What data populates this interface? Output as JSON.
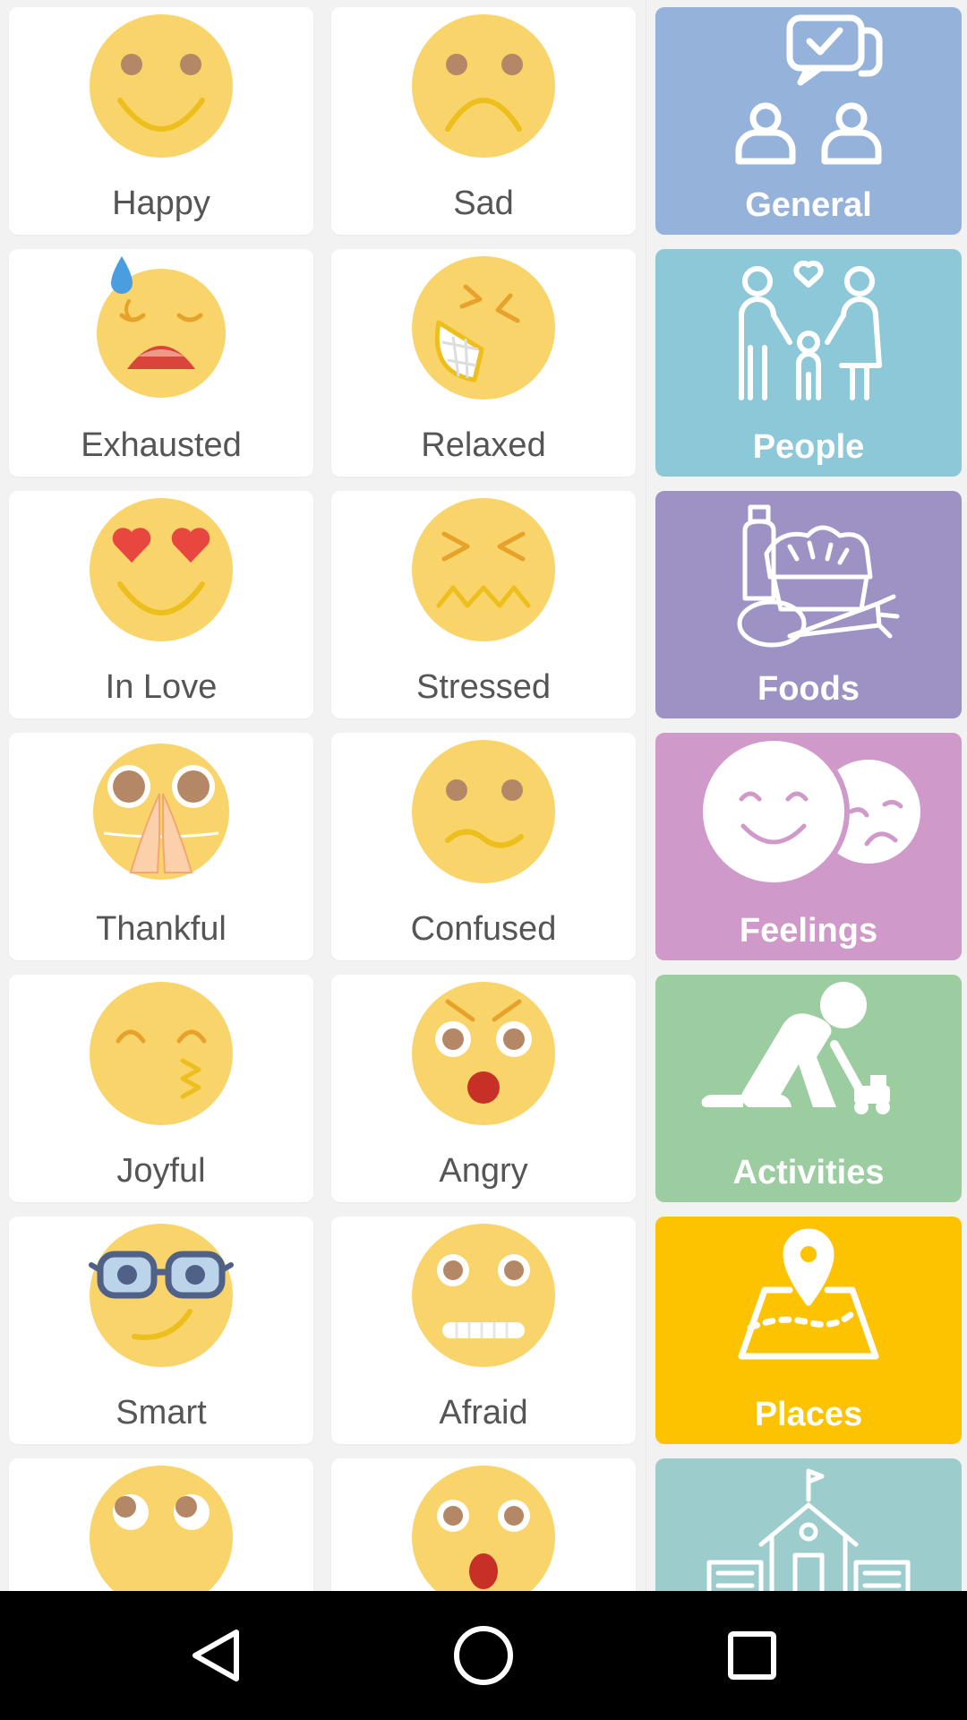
{
  "emotions": [
    {
      "label": "Happy",
      "icon": "happy-face-icon"
    },
    {
      "label": "Sad",
      "icon": "sad-face-icon"
    },
    {
      "label": "Exhausted",
      "icon": "exhausted-face-icon"
    },
    {
      "label": "Relaxed",
      "icon": "relaxed-face-icon"
    },
    {
      "label": "In Love",
      "icon": "in-love-face-icon"
    },
    {
      "label": "Stressed",
      "icon": "stressed-face-icon"
    },
    {
      "label": "Thankful",
      "icon": "thankful-face-icon"
    },
    {
      "label": "Confused",
      "icon": "confused-face-icon"
    },
    {
      "label": "Joyful",
      "icon": "joyful-face-icon"
    },
    {
      "label": "Angry",
      "icon": "angry-face-icon"
    },
    {
      "label": "Smart",
      "icon": "smart-face-icon"
    },
    {
      "label": "Afraid",
      "icon": "afraid-face-icon"
    }
  ],
  "categories": [
    {
      "label": "General",
      "icon": "people-chat-icon",
      "color": "#95b3da"
    },
    {
      "label": "People",
      "icon": "family-icon",
      "color": "#8dc8d8"
    },
    {
      "label": "Foods",
      "icon": "groceries-icon",
      "color": "#9e92c4"
    },
    {
      "label": "Feelings",
      "icon": "masks-icon",
      "color": "#cf99c9"
    },
    {
      "label": "Activities",
      "icon": "child-playing-icon",
      "color": "#9bcda1"
    },
    {
      "label": "Places",
      "icon": "map-pin-icon",
      "color": "#fdc300"
    },
    {
      "label": "",
      "icon": "school-icon",
      "color": "#9dcccc"
    }
  ],
  "colors": {
    "face": "#f8d46a",
    "eye": "#b48866",
    "mouth": "#ecbf1d"
  },
  "nav": {
    "back": "back-icon",
    "home": "home-icon",
    "recents": "recents-icon"
  }
}
